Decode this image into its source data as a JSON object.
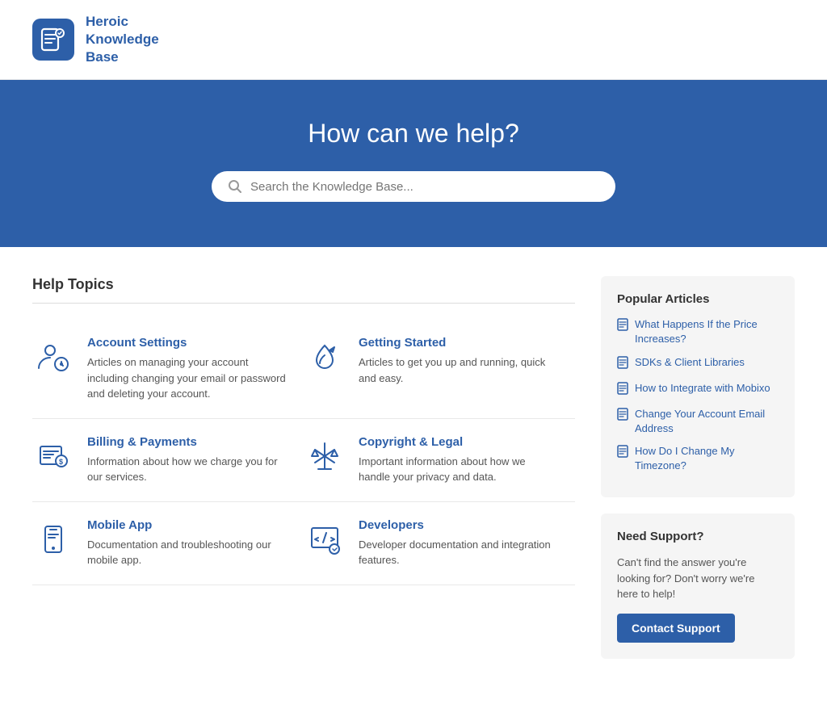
{
  "header": {
    "brand_name": "Heroic\nKnowledge\nBase"
  },
  "hero": {
    "title": "How can we help?",
    "search_placeholder": "Search the Knowledge Base..."
  },
  "help_topics": {
    "section_label": "Help Topics",
    "topics": [
      {
        "id": "account-settings",
        "title": "Account Settings",
        "description": "Articles on managing your account including changing your email or password and deleting your account.",
        "icon": "account"
      },
      {
        "id": "getting-started",
        "title": "Getting Started",
        "description": "Articles to get you up and running, quick and easy.",
        "icon": "rocket"
      },
      {
        "id": "billing-payments",
        "title": "Billing & Payments",
        "description": "Information about how we charge you for our services.",
        "icon": "billing"
      },
      {
        "id": "copyright-legal",
        "title": "Copyright & Legal",
        "description": "Important information about how we handle your privacy and data.",
        "icon": "legal"
      },
      {
        "id": "mobile-app",
        "title": "Mobile App",
        "description": "Documentation and troubleshooting our mobile app.",
        "icon": "mobile"
      },
      {
        "id": "developers",
        "title": "Developers",
        "description": "Developer documentation and integration features.",
        "icon": "developers"
      }
    ]
  },
  "sidebar": {
    "popular_articles": {
      "title": "Popular Articles",
      "articles": [
        {
          "label": "What Happens If the Price Increases?"
        },
        {
          "label": "SDKs & Client Libraries"
        },
        {
          "label": "How to Integrate with Mobixo"
        },
        {
          "label": "Change Your Account Email Address"
        },
        {
          "label": "How Do I Change My Timezone?"
        }
      ]
    },
    "need_support": {
      "title": "Need Support?",
      "description": "Can't find the answer you're looking for? Don't worry we're here to help!",
      "button_label": "Contact Support"
    }
  }
}
